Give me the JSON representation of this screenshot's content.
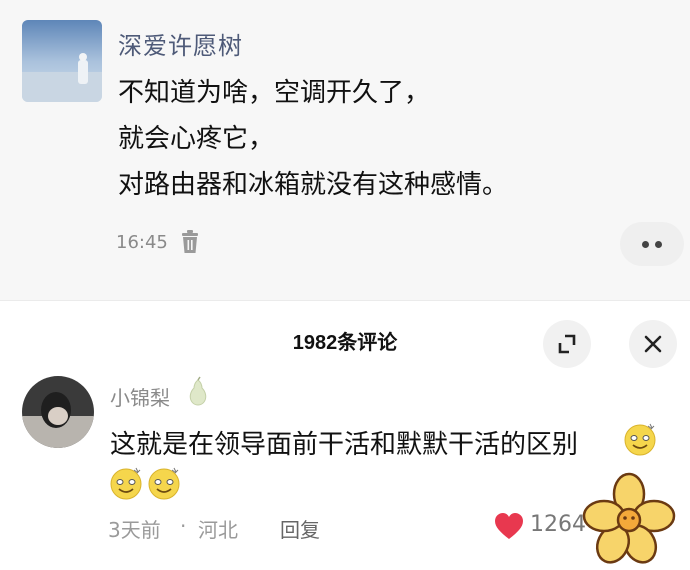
{
  "post": {
    "author": "深爱许愿树",
    "lines": [
      "不知道为啥，空调开久了，",
      "就会心疼它，",
      "对路由器和冰箱就没有这种感情。"
    ],
    "time": "16:45"
  },
  "comments_sheet": {
    "title": "1982条评论"
  },
  "comment": {
    "username": "小锦梨",
    "text": "这就是在领导面前干活和默默干活的区别",
    "time": "3天前",
    "separator": "·",
    "location": "河北",
    "reply_label": "回复",
    "like_count": "1264"
  },
  "icons": [
    "trash-icon",
    "more-dots-icon",
    "expand-icon",
    "close-icon",
    "pear-badge-icon",
    "smile-emoji-icon",
    "heart-icon",
    "flower-sticker"
  ],
  "colors": {
    "author": "#4e5a78",
    "like": "#e8384f",
    "muted": "#8a8a8a"
  }
}
